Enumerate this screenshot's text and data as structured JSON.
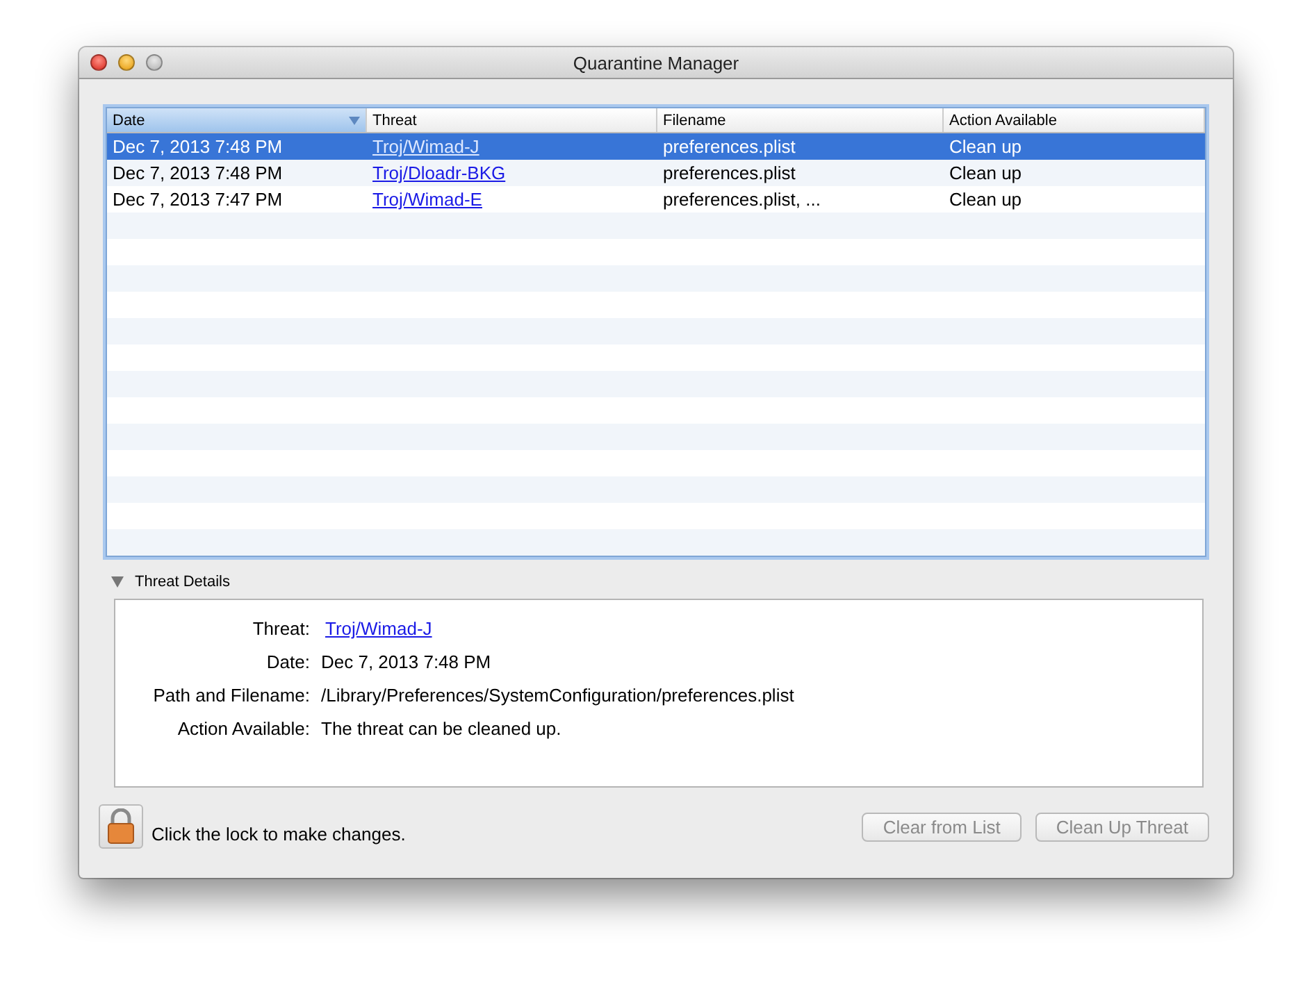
{
  "window": {
    "title": "Quarantine Manager"
  },
  "table": {
    "columns": [
      {
        "label": "Date",
        "sorted": true
      },
      {
        "label": "Threat",
        "sorted": false
      },
      {
        "label": "Filename",
        "sorted": false
      },
      {
        "label": "Action Available",
        "sorted": false
      }
    ],
    "rows": [
      {
        "date": "Dec 7, 2013 7:48 PM",
        "threat": "Troj/Wimad-J",
        "filename": "preferences.plist",
        "action": "Clean up",
        "selected": true
      },
      {
        "date": "Dec 7, 2013 7:48 PM",
        "threat": "Troj/Dloadr-BKG",
        "filename": "preferences.plist",
        "action": "Clean up",
        "selected": false
      },
      {
        "date": "Dec 7, 2013 7:47 PM",
        "threat": "Troj/Wimad-E",
        "filename": "preferences.plist, ...",
        "action": "Clean up",
        "selected": false
      }
    ]
  },
  "details": {
    "title": "Threat Details",
    "expanded": true,
    "fields": [
      {
        "label": "Threat:",
        "value": "Troj/Wimad-J",
        "kind": "link"
      },
      {
        "label": "Date:",
        "value": "Dec 7, 2013 7:48 PM",
        "kind": "text"
      },
      {
        "label": "Path and Filename:",
        "value": "/Library/Preferences/SystemConfiguration/preferences.plist",
        "kind": "text"
      },
      {
        "label": "Action Available:",
        "value": "The threat can be cleaned up.",
        "kind": "text"
      }
    ]
  },
  "footer": {
    "lock_hint": "Click the lock to make changes.",
    "buttons": [
      {
        "label": "Clear from List",
        "disabled": true
      },
      {
        "label": "Clean Up Threat",
        "disabled": true
      }
    ]
  }
}
